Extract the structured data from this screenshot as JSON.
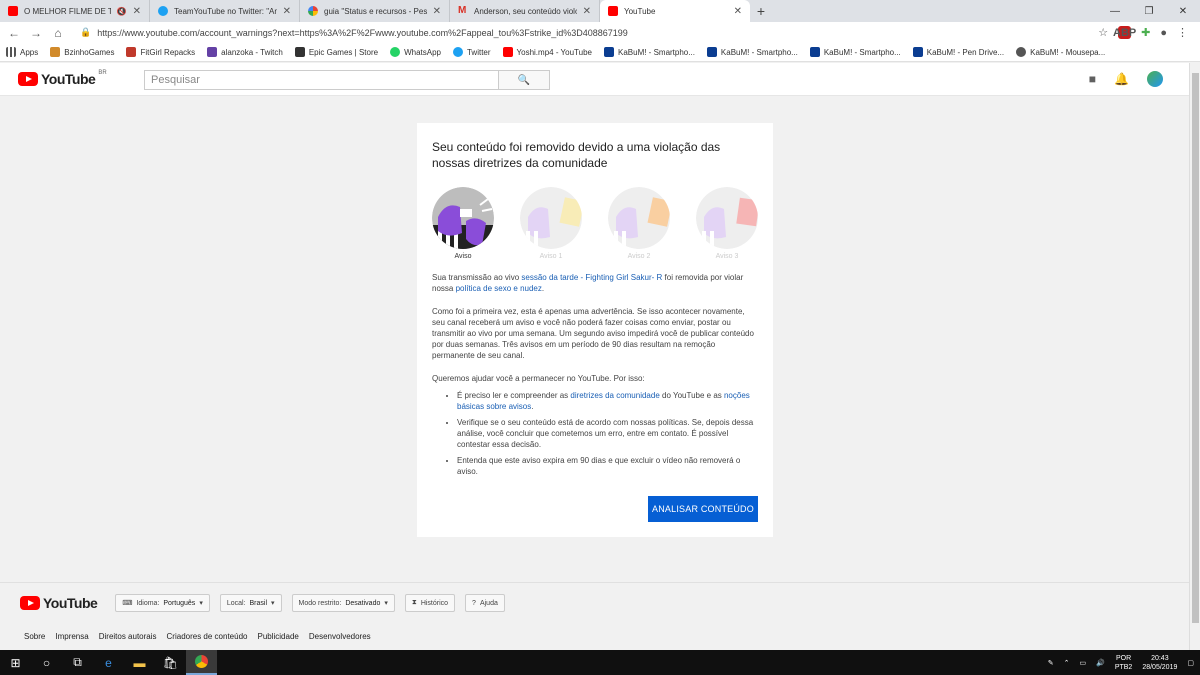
{
  "browser": {
    "tabs": [
      {
        "title": "O MELHOR FILME DE TERROR",
        "favicon": "youtube",
        "muted": true
      },
      {
        "title": "TeamYouTube no Twitter: \"Anders",
        "favicon": "twitter"
      },
      {
        "title": "guia \"Status e recursos - Pesquisa",
        "favicon": "google"
      },
      {
        "title": "Anderson, seu conteúdo violou a",
        "favicon": "gmail"
      },
      {
        "title": "YouTube",
        "favicon": "youtube",
        "active": true
      }
    ],
    "url": "https://www.youtube.com/account_warnings?next=https%3A%2F%2Fwww.youtube.com%2Fappeal_tou%3Fstrike_id%3D408867199",
    "bookmarks": [
      {
        "label": "Apps",
        "icon": "apps"
      },
      {
        "label": "BzinhoGames",
        "icon": "bz"
      },
      {
        "label": "FitGirl Repacks",
        "icon": "fitgirl"
      },
      {
        "label": "alanzoka - Twitch",
        "icon": "twitch"
      },
      {
        "label": "Epic Games | Store",
        "icon": "epic"
      },
      {
        "label": "WhatsApp",
        "icon": "whatsapp"
      },
      {
        "label": "Twitter",
        "icon": "twitter"
      },
      {
        "label": "Yoshi.mp4 - YouTube",
        "icon": "youtube"
      },
      {
        "label": "KaBuM! - Smartpho...",
        "icon": "kabum"
      },
      {
        "label": "KaBuM! - Smartpho...",
        "icon": "kabum"
      },
      {
        "label": "KaBuM! - Smartpho...",
        "icon": "kabum"
      },
      {
        "label": "KaBuM! - Pen Drive...",
        "icon": "kabum"
      },
      {
        "label": "KaBuM! - Mousepa...",
        "icon": "kabum-mouse"
      }
    ]
  },
  "youtube": {
    "logo_text": "YouTube",
    "country": "BR",
    "search_placeholder": "Pesquisar"
  },
  "card": {
    "title": "Seu conteúdo foi removido devido a uma violação das nossas diretrizes da comunidade",
    "strikes": [
      {
        "label": "Aviso",
        "active": true,
        "accent": "#8a4dd9"
      },
      {
        "label": "Aviso 1",
        "active": false,
        "accent": "#f5d76e"
      },
      {
        "label": "Aviso 2",
        "active": false,
        "accent": "#f39c4a"
      },
      {
        "label": "Aviso 3",
        "active": false,
        "accent": "#e84c4c"
      }
    ],
    "p1_pre": "Sua transmissão ao vivo ",
    "p1_link1": "sessão da tarde - Fighting Girl Sakur- R",
    "p1_mid": " foi removida por violar nossa ",
    "p1_link2": "política de sexo e nudez",
    "p1_post": ".",
    "p2": "Como foi a primeira vez, esta é apenas uma advertência. Se isso acontecer novamente, seu canal receberá um aviso e você não poderá fazer coisas como enviar, postar ou transmitir ao vivo por uma semana. Um segundo aviso impedirá você de publicar conteúdo por duas semanas. Três avisos em um período de 90 dias resultam na remoção permanente de seu canal.",
    "p3": "Queremos ajudar você a permanecer no YouTube. Por isso:",
    "b1_pre": "É preciso ler e compreender as ",
    "b1_link1": "diretrizes da comunidade",
    "b1_mid": " do YouTube e as ",
    "b1_link2": "noções básicas sobre avisos",
    "b1_post": ".",
    "b2": "Verifique se o seu conteúdo está de acordo com nossas políticas. Se, depois dessa análise, você concluir que cometemos um erro, entre em contato. É possível contestar essa decisão.",
    "b3": "Entenda que este aviso expira em 90 dias e que excluir o vídeo não removerá o aviso.",
    "button": "ANALISAR CONTEÚDO"
  },
  "footer": {
    "language_label": "Idioma:",
    "language_value": "Português",
    "location_label": "Local:",
    "location_value": "Brasil",
    "restricted_label": "Modo restrito:",
    "restricted_value": "Desativado",
    "history": "Histórico",
    "help": "Ajuda",
    "links": [
      "Sobre",
      "Imprensa",
      "Direitos autorais",
      "Criadores de conteúdo",
      "Publicidade",
      "Desenvolvedores"
    ]
  },
  "taskbar": {
    "lang1": "POR",
    "lang2": "PTB2",
    "time": "20:43",
    "date": "28/05/2019"
  },
  "colors": {
    "youtube_red": "#ff0000",
    "link": "#1a5fb4",
    "button": "#065fd4"
  }
}
